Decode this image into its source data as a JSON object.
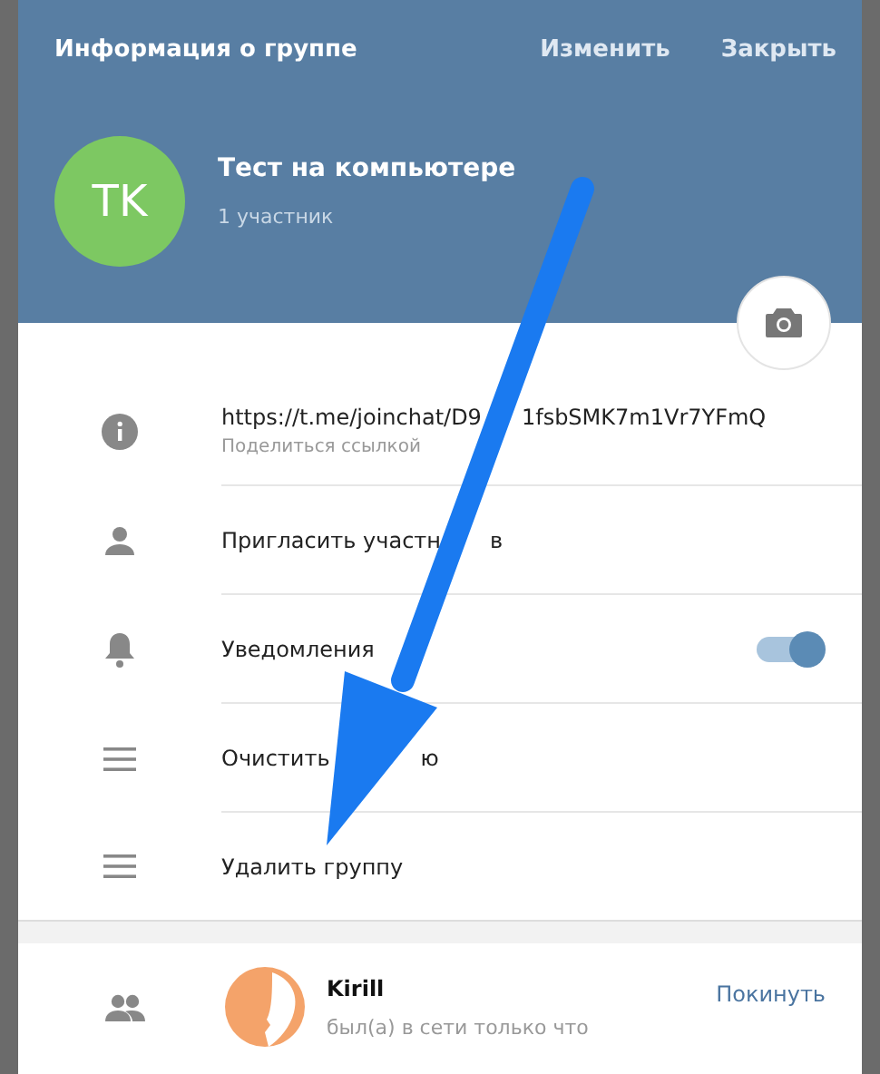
{
  "header": {
    "title": "Информация о группе",
    "actions": [
      "Изменить",
      "Закрыть"
    ]
  },
  "group": {
    "initials": "TK",
    "name": "Тест на компьютере",
    "members_count": "1 участник"
  },
  "rows": [
    {
      "kind": "link",
      "link_parts": [
        "https://t.me/joinchat/D9",
        "1fsbSMK7m1Vr7YFmQ"
      ],
      "hint": "Поделиться ссылкой"
    },
    {
      "kind": "action",
      "label_parts": [
        "Пригласить участн",
        "в"
      ]
    },
    {
      "kind": "toggle",
      "label": "Уведомления",
      "on": true
    },
    {
      "kind": "action",
      "label_parts": [
        "Очистить",
        "ю"
      ]
    },
    {
      "kind": "action",
      "label_parts": [
        "Удалить группу"
      ]
    }
  ],
  "members": [
    {
      "name": "Kirill",
      "status": "был(а) в сети только что",
      "action": "Покинуть"
    }
  ]
}
